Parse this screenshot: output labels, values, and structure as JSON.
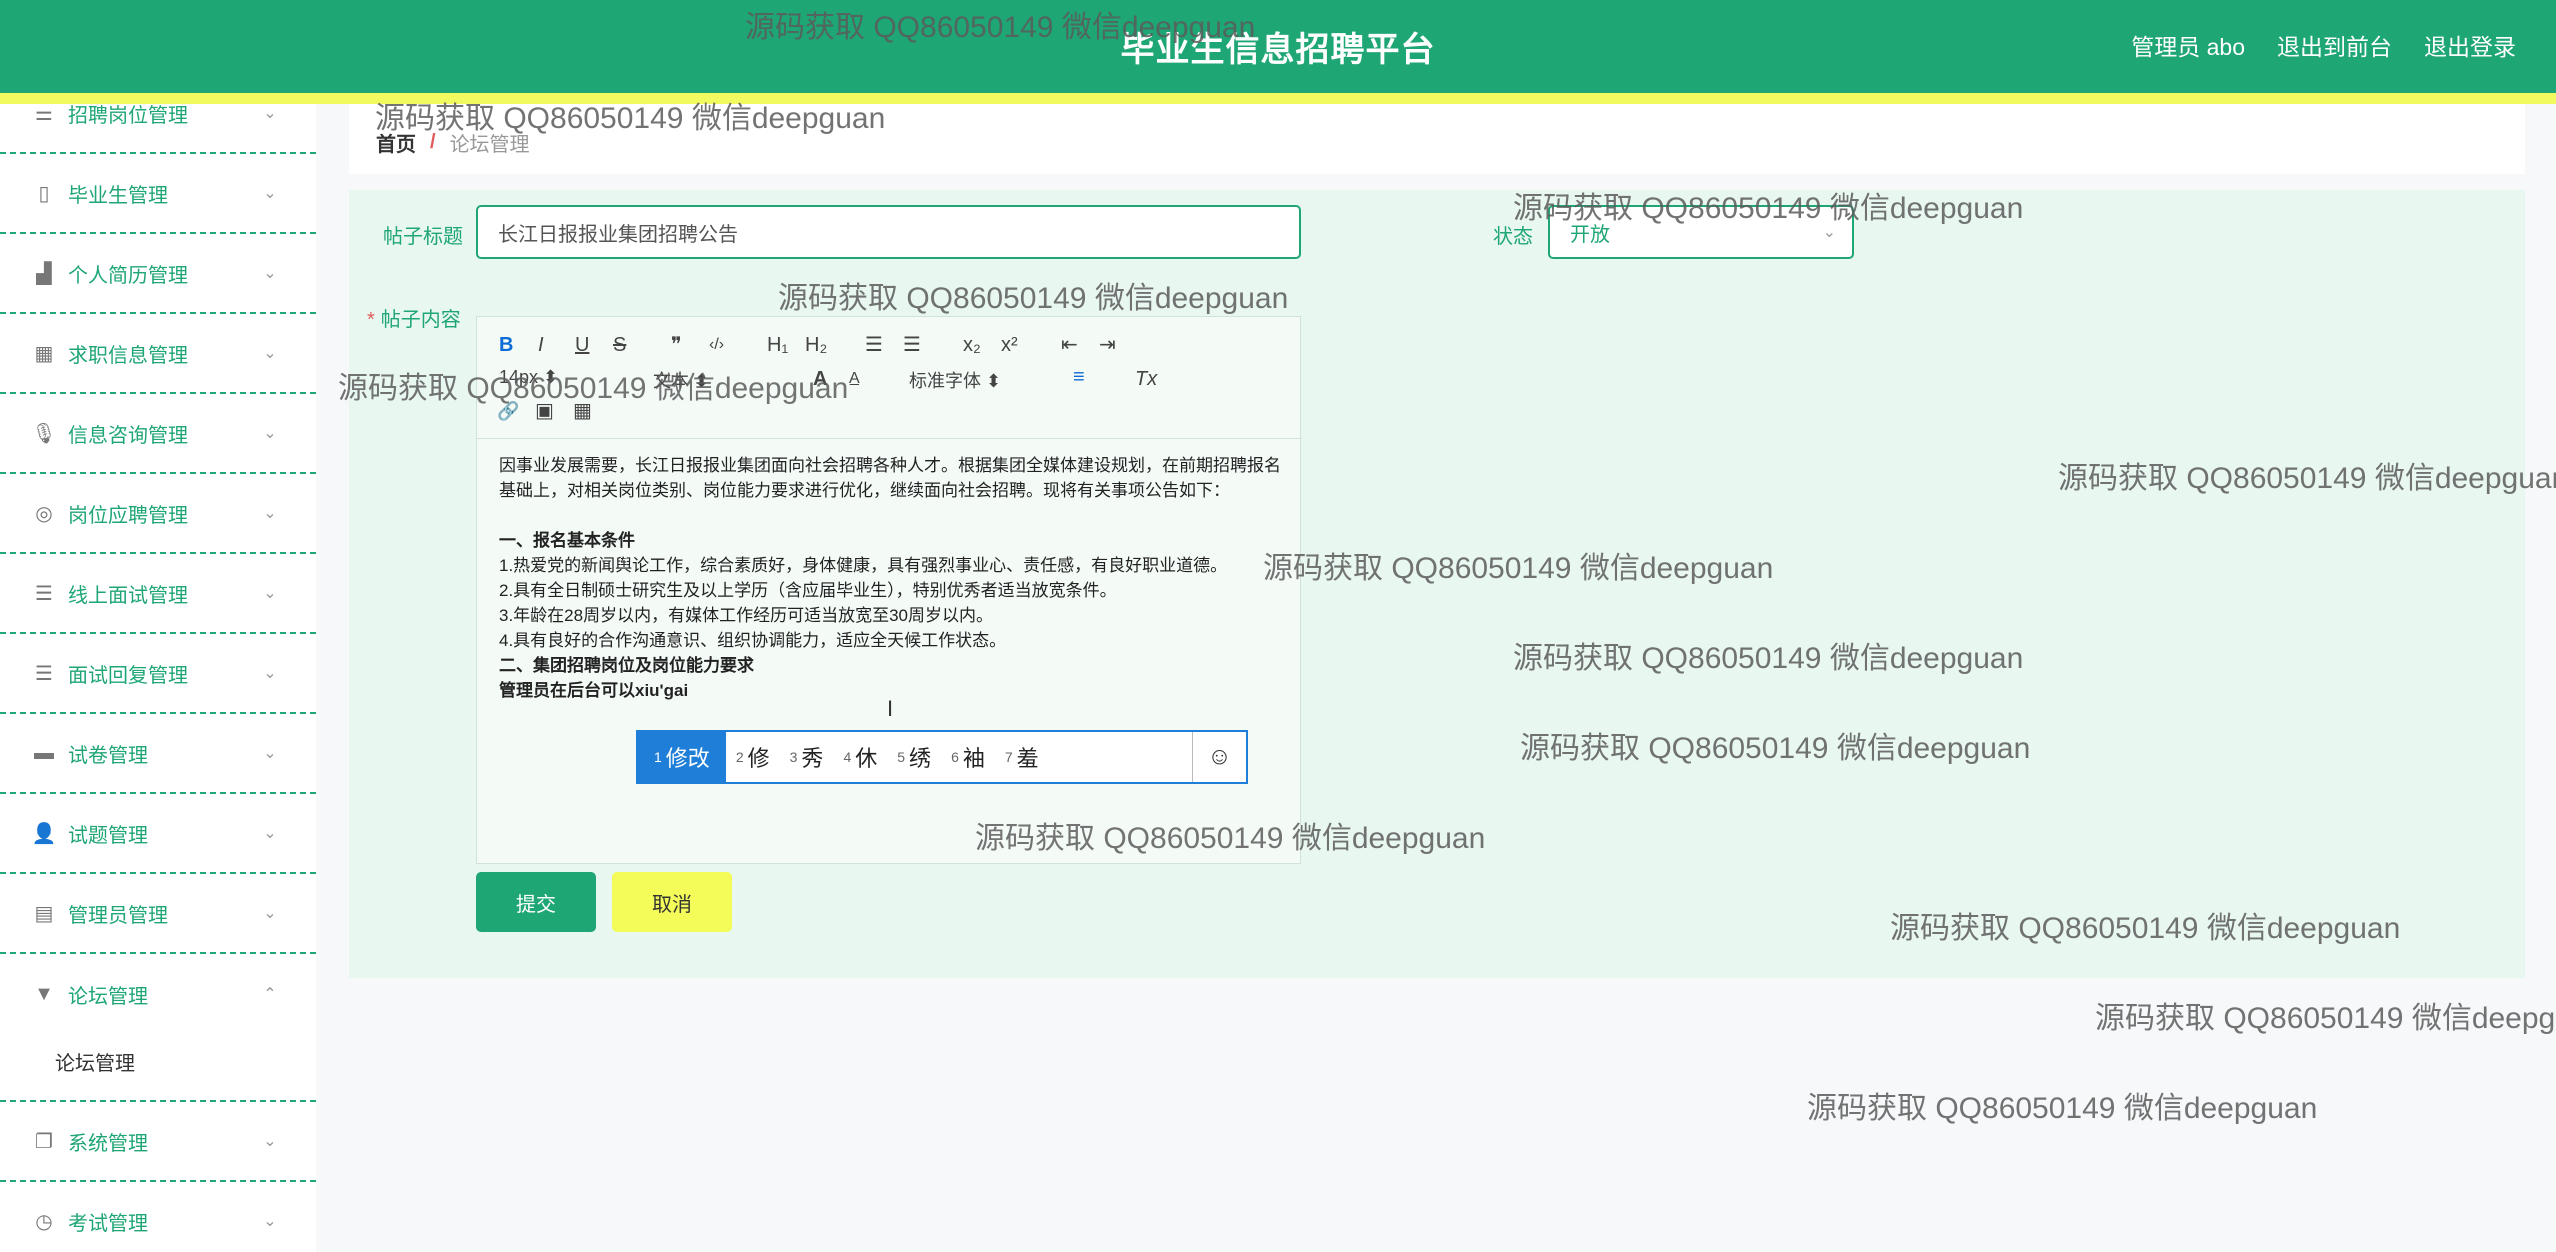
{
  "header": {
    "title": "毕业生信息招聘平台",
    "links": [
      "管理员 abo",
      "退出到前台",
      "退出登录"
    ]
  },
  "sidebar": {
    "items": [
      {
        "label": "招聘岗位管理",
        "icon": "sliders-icon"
      },
      {
        "label": "毕业生管理",
        "icon": "phone-icon"
      },
      {
        "label": "个人简历管理",
        "icon": "bar-chart-icon"
      },
      {
        "label": "求职信息管理",
        "icon": "grid-icon"
      },
      {
        "label": "信息咨询管理",
        "icon": "microphone-icon"
      },
      {
        "label": "岗位应聘管理",
        "icon": "compass-icon"
      },
      {
        "label": "线上面试管理",
        "icon": "list-icon"
      },
      {
        "label": "面试回复管理",
        "icon": "list-icon"
      },
      {
        "label": "试卷管理",
        "icon": "monitor-icon"
      },
      {
        "label": "试题管理",
        "icon": "user-icon"
      },
      {
        "label": "管理员管理",
        "icon": "clipboard-icon"
      },
      {
        "label": "论坛管理",
        "icon": "brush-icon",
        "expanded": true
      },
      {
        "label": "系统管理",
        "icon": "copy-icon"
      },
      {
        "label": "考试管理",
        "icon": "clock-icon"
      }
    ],
    "sub_item": "论坛管理"
  },
  "breadcrumb": {
    "home": "首页",
    "separator": "/",
    "current": "论坛管理"
  },
  "form": {
    "title_label": "帖子标题",
    "title_value": "长江日报报业集团招聘公告",
    "status_label": "状态",
    "status_value": "开放",
    "content_label": "帖子内容"
  },
  "toolbar": {
    "bold": "B",
    "italic": "I",
    "underline": "U",
    "strike": "S",
    "quote": "❞",
    "code": "‹/›",
    "h1": "H₁",
    "h2": "H₂",
    "ol": "☰",
    "ul": "☰",
    "sub": "x₂",
    "sup": "x²",
    "outdent": "⇤",
    "indent": "⇥",
    "size_select": "14px",
    "heading_select": "文本",
    "font_select": "标准字体",
    "align": "≡",
    "clear": "Tx",
    "link": "🔗",
    "image": "▣",
    "video": "▦"
  },
  "content": {
    "lines": [
      "因事业发展需要，长江日报报业集团面向社会招聘各种人才。根据集团全媒体建设规划，在前期招聘报名基础上，对相关岗位类别、岗位能力要求进行优化，继续面向社会招聘。现将有关事项公告如下：",
      "",
      "一、报名基本条件",
      "1.热爱党的新闻舆论工作，综合素质好，身体健康，具有强烈事业心、责任感，有良好职业道德。",
      "2.具有全日制硕士研究生及以上学历（含应届毕业生），特别优秀者适当放宽条件。",
      "3.年龄在28周岁以内，有媒体工作经历可适当放宽至30周岁以内。",
      "4.具有良好的合作沟通意识、组织协调能力，适应全天候工作状态。",
      "二、集团招聘岗位及岗位能力要求",
      "管理员在后台可以xiu'gai"
    ]
  },
  "ime": {
    "candidates": [
      {
        "num": "1",
        "text": "修改"
      },
      {
        "num": "2",
        "text": "修"
      },
      {
        "num": "3",
        "text": "秀"
      },
      {
        "num": "4",
        "text": "休"
      },
      {
        "num": "5",
        "text": "绣"
      },
      {
        "num": "6",
        "text": "袖"
      },
      {
        "num": "7",
        "text": "羞"
      }
    ],
    "emoji": "☺"
  },
  "buttons": {
    "submit": "提交",
    "cancel": "取消"
  },
  "watermark": "源码获取 QQ86050149 微信deepguan",
  "colors": {
    "primary": "#1fa675",
    "accent_yellow": "#f3fc59",
    "ime_blue": "#1f7fd8"
  }
}
